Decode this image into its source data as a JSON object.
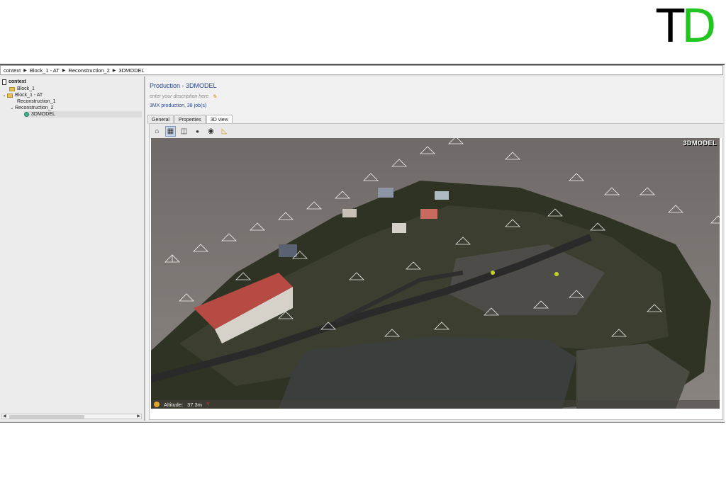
{
  "logo": {
    "t": "T",
    "d": "D"
  },
  "breadcrumb": [
    "context",
    "Block_1 - AT",
    "Reconstruction_2",
    "3DMODEL"
  ],
  "tree": {
    "root": "context",
    "items": [
      {
        "label": "Block_1"
      },
      {
        "label": "Block_1 - AT"
      },
      {
        "label": "Reconstruction_1"
      },
      {
        "label": "Reconstruction_2"
      },
      {
        "label": "3DMODEL"
      }
    ]
  },
  "main": {
    "title": "Production - 3DMODEL",
    "description_placeholder": "enter your description here",
    "jobs": "3MX production, 38 job(s)",
    "tabs": [
      "General",
      "Properties",
      "3D view"
    ],
    "active_tab": "3D view"
  },
  "viewer": {
    "label": "3DMODEL",
    "altitude_label": "Altitude:",
    "altitude_value": "37.3m",
    "axis": "Y"
  },
  "colors": {
    "accent": "#28488a",
    "logo_green": "#22c41f",
    "roof_red": "#b84a44",
    "ok": "#45b090"
  },
  "icons": [
    "home-icon",
    "checker-icon",
    "bbox-icon",
    "camera-small-icon",
    "camera-icon",
    "ruler-icon",
    "pencil-icon",
    "folder-icon",
    "check-status-icon",
    "sun-icon"
  ]
}
